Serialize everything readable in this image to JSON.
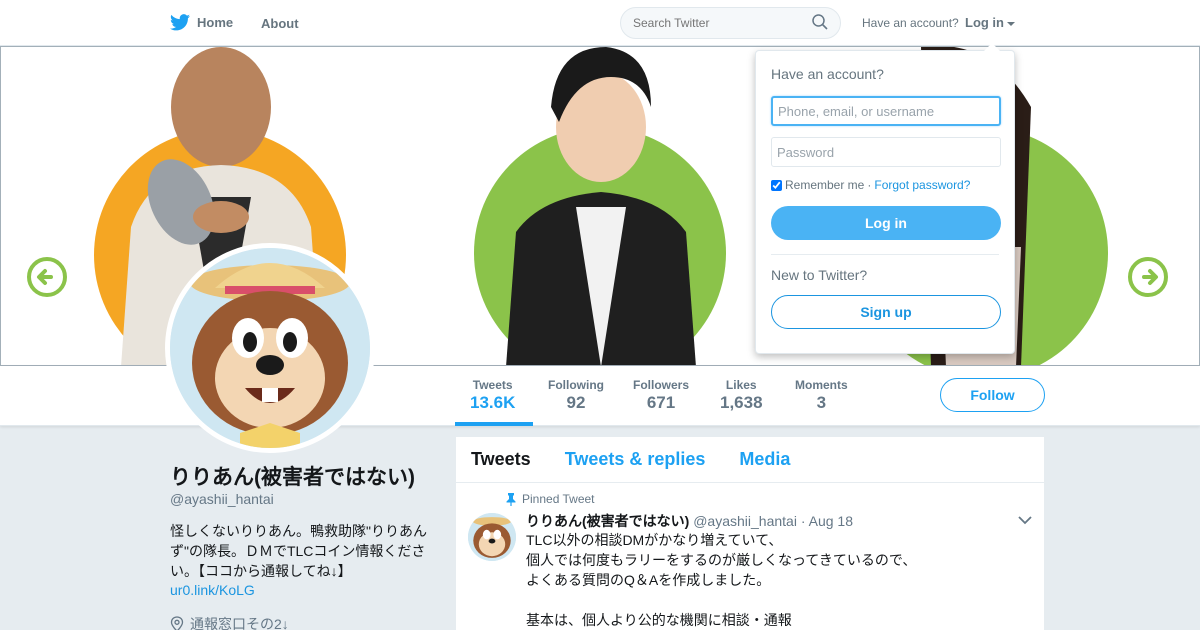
{
  "nav": {
    "home_label": "Home",
    "about_label": "About",
    "search_placeholder": "Search Twitter",
    "have_account_label": "Have an account?",
    "login_label": "Log in"
  },
  "login_dropdown": {
    "title": "Have an account?",
    "username_placeholder": "Phone, email, or username",
    "password_placeholder": "Password",
    "remember_label": "Remember me",
    "separator": "·",
    "forgot_label": "Forgot password?",
    "login_button": "Log in",
    "new_label": "New to Twitter?",
    "signup_button": "Sign up"
  },
  "stats": [
    {
      "label": "Tweets",
      "value": "13.6K"
    },
    {
      "label": "Following",
      "value": "92"
    },
    {
      "label": "Followers",
      "value": "671"
    },
    {
      "label": "Likes",
      "value": "1,638"
    },
    {
      "label": "Moments",
      "value": "3"
    }
  ],
  "follow_button": "Follow",
  "profile": {
    "name": "りりあん(被害者ではない)",
    "handle": "@ayashii_hantai",
    "bio": "怪しくないりりあん。鴨救助隊\"りりあんず\"の隊長。ＤＭでTLCコイン情報ください。【ココから通報してね↓】",
    "link": "ur0.link/KoLG",
    "location": "通報窓口その2↓"
  },
  "timeline": {
    "tabs": [
      "Tweets",
      "Tweets & replies",
      "Media"
    ],
    "pinned_label": "Pinned Tweet",
    "tweet": {
      "name": "りりあん(被害者ではない)",
      "handle": "@ayashii_hantai",
      "date": "· Aug 18",
      "text": "TLC以外の相談DMがかなり増えていて、\n個人では何度もラリーをするのが厳しくなってきているので、\nよくある質問のQ＆Aを作成しました。\n\n基本は、個人より公的な機関に相談・通報"
    }
  },
  "colors": {
    "twitter_blue": "#1da1f2",
    "banner_green": "#8bc34a",
    "banner_orange": "#f5a623"
  }
}
